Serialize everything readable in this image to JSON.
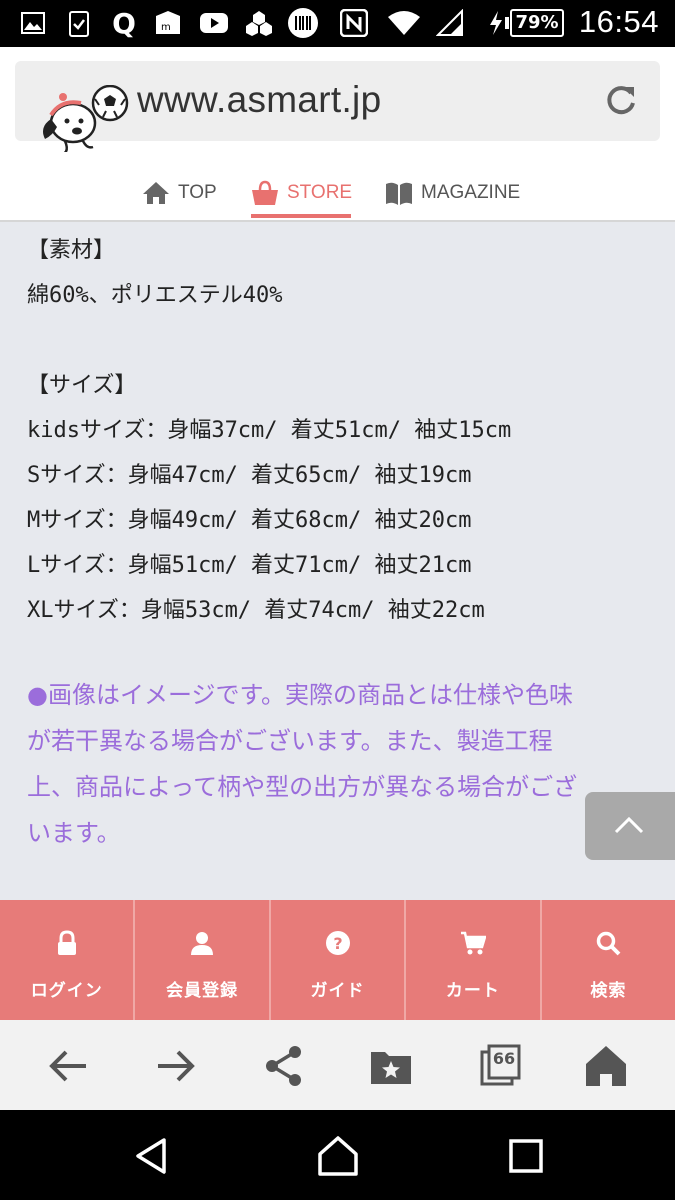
{
  "status_bar": {
    "time": "16:54",
    "battery": "79%",
    "icons": [
      "gallery-icon",
      "clipboard-check-icon",
      "q-app-icon",
      "mail-app-icon",
      "youtube-icon",
      "cluster-icon",
      "barcode-icon",
      "nfc-icon",
      "wifi-icon",
      "signal-icon",
      "charging-icon"
    ]
  },
  "browser": {
    "url": "www.asmart.jp",
    "reload_icon": "reload-icon"
  },
  "site_nav": {
    "items": [
      {
        "label": "TOP",
        "icon": "home-icon"
      },
      {
        "label": "STORE",
        "icon": "shopping-bag-icon",
        "active": true
      },
      {
        "label": "MAGAZINE",
        "icon": "book-icon"
      }
    ],
    "accent_color": "#e8716f"
  },
  "content": {
    "material_heading": "【素材】",
    "material": "綿60%、ポリエステル40%",
    "size_heading": "【サイズ】",
    "sizes": [
      "kidsサイズ：身幅37cm/ 着丈51cm/ 袖丈15cm",
      "Sサイズ：身幅47cm/ 着丈65cm/ 袖丈19cm",
      "Mサイズ：身幅49cm/ 着丈68cm/ 袖丈20cm",
      "Lサイズ：身幅51cm/ 着丈71cm/ 袖丈21cm",
      "XLサイズ：身幅53cm/ 着丈74cm/ 袖丈22cm"
    ],
    "notice_lines": [
      "●画像はイメージです。実際の商品とは仕様や色味",
      "が若干異なる場合がございます。また、製造工程",
      "上、商品によって柄や型の出方が異なる場合がござ",
      "います。"
    ],
    "notice_color": "#9b6ddb"
  },
  "footer_nav": {
    "items": [
      {
        "label": "ログイン",
        "icon": "lock-icon"
      },
      {
        "label": "会員登録",
        "icon": "user-icon"
      },
      {
        "label": "ガイド",
        "icon": "help-icon"
      },
      {
        "label": "カート",
        "icon": "cart-icon"
      },
      {
        "label": "検索",
        "icon": "search-icon"
      }
    ],
    "color": "#e77b79"
  },
  "browser_toolbar": {
    "tab_count": "66",
    "icons": [
      "back-arrow-icon",
      "forward-arrow-icon",
      "share-icon",
      "bookmarks-icon",
      "tabs-icon",
      "home-icon"
    ]
  },
  "android_nav": {
    "icons": [
      "back-triangle-icon",
      "home-circle-icon",
      "recents-square-icon"
    ]
  }
}
